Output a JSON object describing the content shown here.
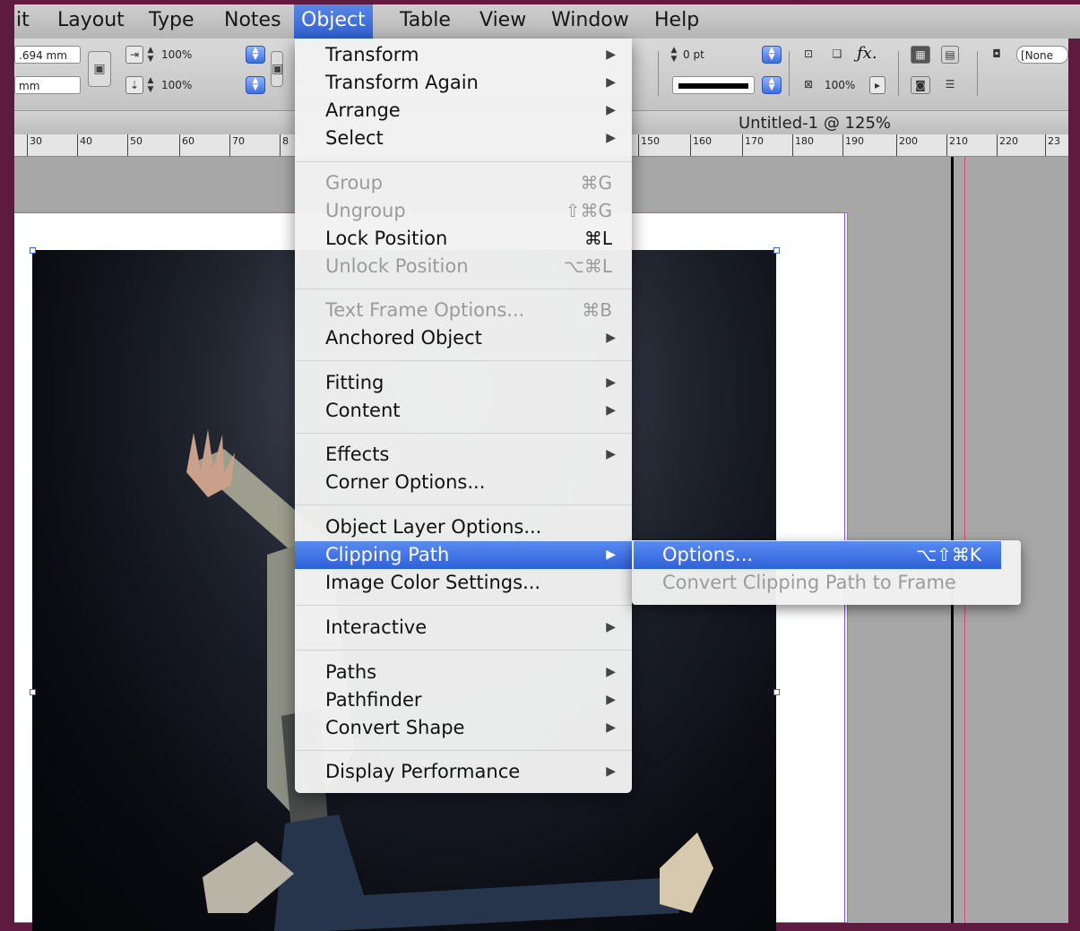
{
  "menubar": {
    "items": [
      {
        "label": "it"
      },
      {
        "label": "Layout"
      },
      {
        "label": "Type"
      },
      {
        "label": "Notes"
      },
      {
        "label": "Object"
      },
      {
        "label": "Table"
      },
      {
        "label": "View"
      },
      {
        "label": "Window"
      },
      {
        "label": "Help"
      }
    ]
  },
  "control_panel": {
    "x_field": ".694 mm",
    "y_field": "mm",
    "scale_x": "100%",
    "scale_y": "100%",
    "stroke_weight": "0 pt",
    "opacity": "100%",
    "object_style": "[None"
  },
  "document": {
    "title": "Untitled-1 @ 125%"
  },
  "ruler": {
    "ticks": [
      "30",
      "40",
      "50",
      "60",
      "70",
      "8",
      "150",
      "160",
      "170",
      "180",
      "190",
      "200",
      "210",
      "220",
      "23"
    ]
  },
  "object_menu": {
    "items": [
      {
        "label": "Transform",
        "submenu": "▶"
      },
      {
        "label": "Transform Again",
        "submenu": "▶"
      },
      {
        "label": "Arrange",
        "submenu": "▶"
      },
      {
        "label": "Select",
        "submenu": "▶"
      },
      {
        "label": "Group",
        "shortcut": "⌘G"
      },
      {
        "label": "Ungroup",
        "shortcut": "⇧⌘G"
      },
      {
        "label": "Lock Position",
        "shortcut": "⌘L"
      },
      {
        "label": "Unlock Position",
        "shortcut": "⌥⌘L"
      },
      {
        "label": "Text Frame Options...",
        "shortcut": "⌘B"
      },
      {
        "label": "Anchored Object",
        "submenu": "▶"
      },
      {
        "label": "Fitting",
        "submenu": "▶"
      },
      {
        "label": "Content",
        "submenu": "▶"
      },
      {
        "label": "Effects",
        "submenu": "▶"
      },
      {
        "label": "Corner Options..."
      },
      {
        "label": "Object Layer Options..."
      },
      {
        "label": "Clipping Path",
        "submenu": "▶"
      },
      {
        "label": "Image Color Settings..."
      },
      {
        "label": "Interactive",
        "submenu": "▶"
      },
      {
        "label": "Paths",
        "submenu": "▶"
      },
      {
        "label": "Pathfinder",
        "submenu": "▶"
      },
      {
        "label": "Convert Shape",
        "submenu": "▶"
      },
      {
        "label": "Display Performance",
        "submenu": "▶"
      }
    ]
  },
  "clipping_submenu": {
    "items": [
      {
        "label": "Options...",
        "shortcut": "⌥⇧⌘K"
      },
      {
        "label": "Convert Clipping Path to Frame"
      }
    ]
  },
  "colors": {
    "highlight": "#2f60d8",
    "desktop": "#5e1a3f",
    "margin_guide": "#b25db6",
    "bleed_guide": "#d74d6f"
  }
}
